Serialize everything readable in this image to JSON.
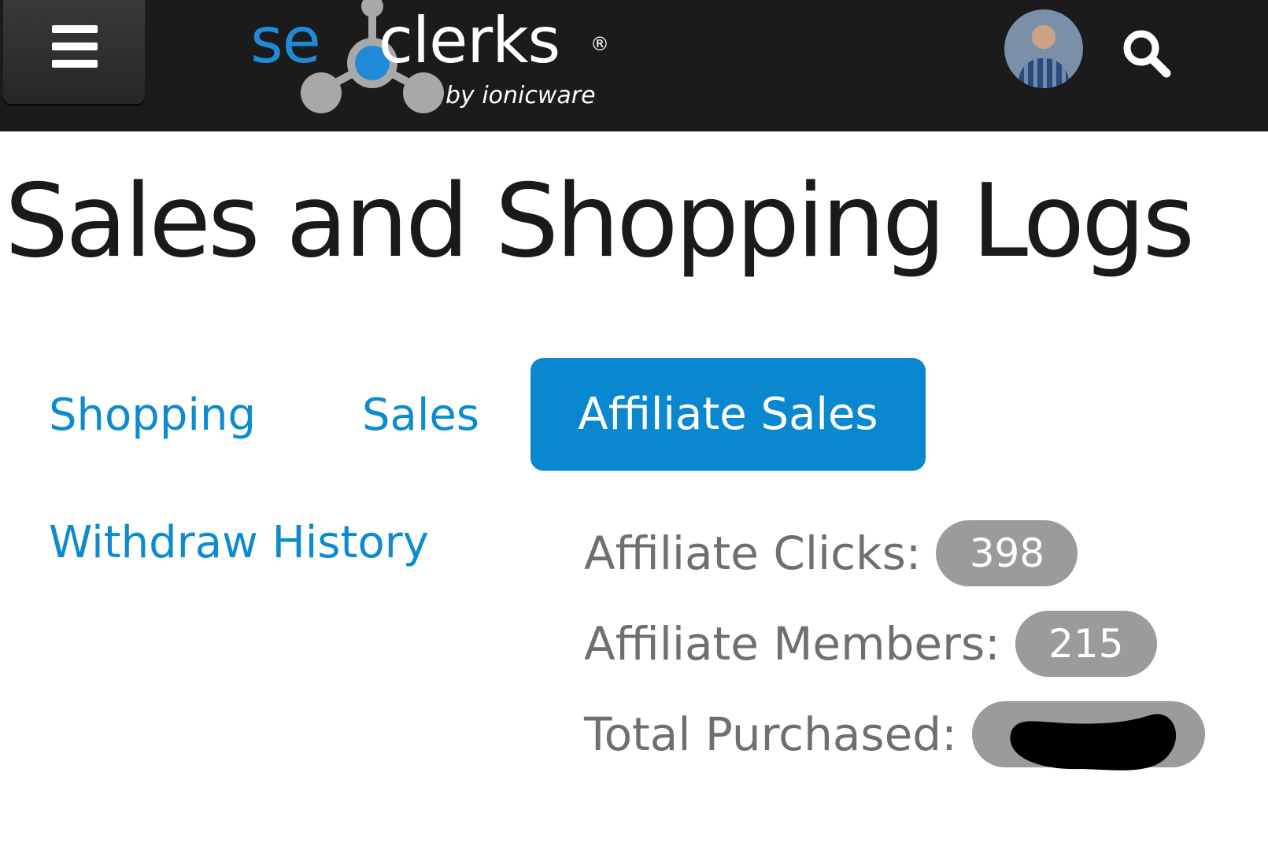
{
  "header": {
    "logo_text_blue": "se",
    "logo_text_white": "clerks",
    "logo_registered": "®",
    "logo_subtitle": "by ionicware",
    "icons": {
      "menu": "hamburger-menu-icon",
      "avatar": "user-avatar",
      "search": "search-icon"
    }
  },
  "page": {
    "title": "Sales and Shopping Logs"
  },
  "tabs": [
    {
      "label": "Shopping",
      "active": false
    },
    {
      "label": "Sales",
      "active": false
    },
    {
      "label": "Affiliate Sales",
      "active": true
    },
    {
      "label": "Withdraw History",
      "active": false
    }
  ],
  "stats": {
    "clicks": {
      "label": "Affiliate Clicks:",
      "value": "398"
    },
    "members": {
      "label": "Affiliate Members:",
      "value": "215"
    },
    "purchased": {
      "label": "Total Purchased:",
      "value": ""
    }
  },
  "colors": {
    "header_bg": "#1b1b1b",
    "accent": "#0987cf",
    "link": "#0d8bd0",
    "badge": "#9b9b9b",
    "logo_blue": "#1f8ad6"
  }
}
